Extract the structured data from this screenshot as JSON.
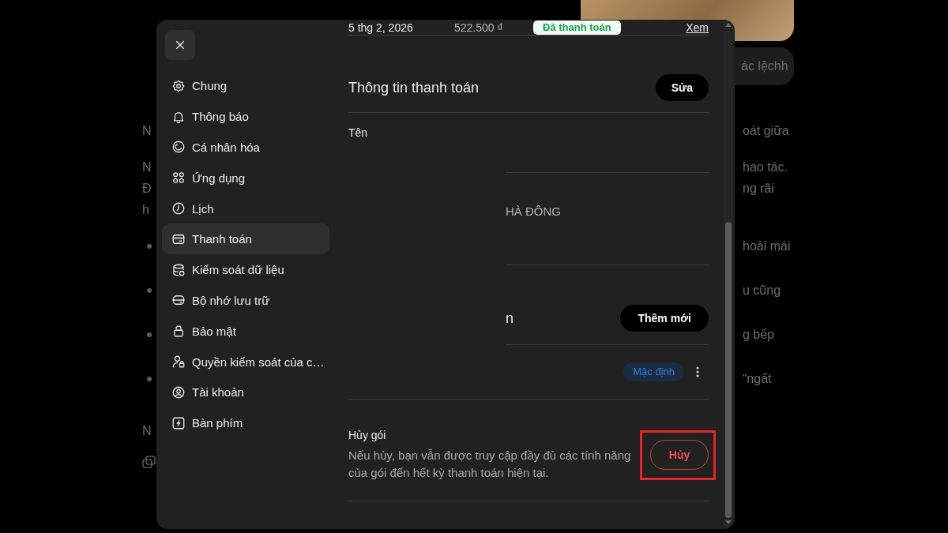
{
  "background_page": {
    "chip": "ác lệchh",
    "blocks": [
      {
        "kind": "paragraph",
        "lines": [
          {
            "left": "N",
            "right": "oát giữa"
          }
        ]
      },
      {
        "kind": "paragraph",
        "lines": [
          {
            "left": "N",
            "right": "hao tác."
          },
          {
            "left": "Đ",
            "right": "ng rãi"
          },
          {
            "left": "h"
          }
        ]
      },
      {
        "kind": "bullet_list",
        "items": [
          {
            "right": "hoải mái"
          },
          {
            "right": "u cũng"
          },
          {
            "right": "g bếp"
          },
          {
            "right": "“ngất"
          }
        ]
      },
      {
        "kind": "paragraph",
        "lines": [
          {
            "left": "N"
          }
        ]
      },
      {
        "kind": "copy_icon"
      }
    ]
  },
  "settings_dialog": {
    "sidebar": {
      "items": [
        {
          "label": "Chung",
          "selected": false
        },
        {
          "label": "Thông báo",
          "selected": false
        },
        {
          "label": "Cá nhân hóa",
          "selected": false
        },
        {
          "label": "Ứng dụng",
          "selected": false
        },
        {
          "label": "Lịch",
          "selected": false
        },
        {
          "label": "Thanh toán",
          "selected": true
        },
        {
          "label": "Kiểm soát dữ liệu",
          "selected": false
        },
        {
          "label": "Bộ nhớ lưu trữ",
          "selected": false
        },
        {
          "label": "Bảo mật",
          "selected": false
        },
        {
          "label": "Quyền kiểm soát của c…",
          "selected": false
        },
        {
          "label": "Tài khoản",
          "selected": false
        },
        {
          "label": "Bàn phím",
          "selected": false
        }
      ]
    },
    "invoice_row": {
      "date": "5 thg 2, 2026",
      "amount": "522.500 ₫",
      "status": "Đã thanh toán",
      "link": "Xem"
    },
    "payment_info": {
      "title": "Thông tin thanh toán",
      "edit_button": "Sửa",
      "name_label": "Tên",
      "address_fragment": "HÀ ĐÔNG"
    },
    "payment_methods": {
      "title_fragment": "n",
      "add_button": "Thêm mới",
      "cards": [
        {
          "badge": "Mặc định"
        }
      ]
    },
    "cancel_plan": {
      "title": "Hủy gói",
      "description": "Nếu hủy, bạn vẫn được truy cập đầy đủ các tính năng của gói đến hết kỳ thanh toán hiện tại.",
      "button": "Hủy",
      "highlighted": true
    }
  }
}
